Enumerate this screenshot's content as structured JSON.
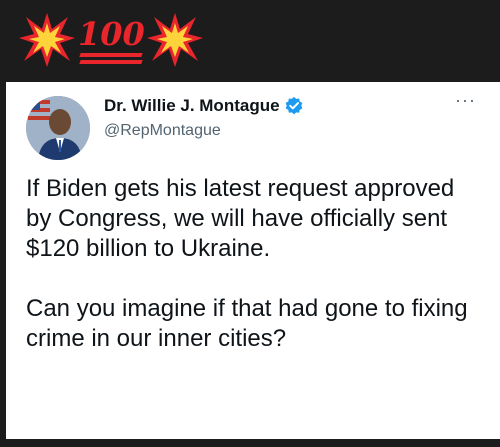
{
  "header": {
    "emoji": [
      "collision-icon",
      "hundred-points-icon",
      "collision-icon"
    ],
    "hundred_text": "100"
  },
  "tweet": {
    "display_name": "Dr. Willie J. Montague",
    "handle": "@RepMontague",
    "more_label": "···",
    "text": "If Biden gets his latest request approved by Congress, we will have officially sent $120 billion to Ukraine.\n\nCan you imagine if that had gone to fixing crime in our inner cities?"
  },
  "colors": {
    "background": "#1c1c1c",
    "card": "#ffffff",
    "verified": "#1d9bf0",
    "emoji_red": "#e8262b",
    "burst_yellow": "#ffd43b"
  }
}
